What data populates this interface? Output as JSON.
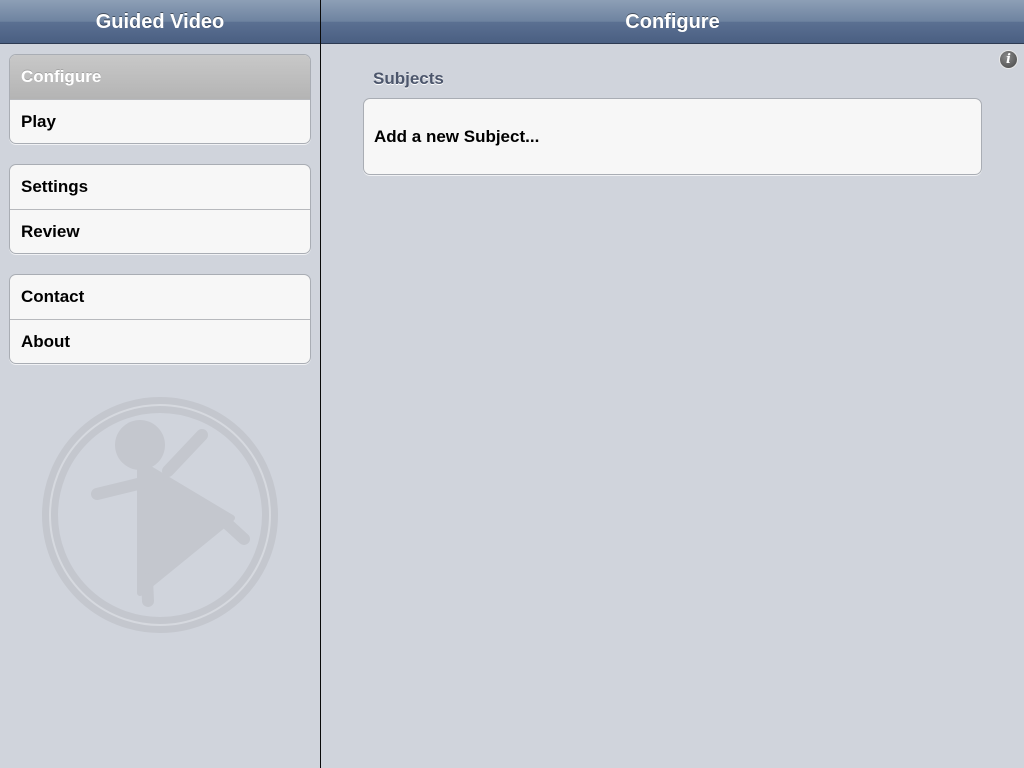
{
  "master": {
    "title": "Guided Video",
    "groups": [
      {
        "items": [
          {
            "label": "Configure",
            "selected": true
          },
          {
            "label": "Play",
            "selected": false
          }
        ]
      },
      {
        "items": [
          {
            "label": "Settings",
            "selected": false
          },
          {
            "label": "Review",
            "selected": false
          }
        ]
      },
      {
        "items": [
          {
            "label": "Contact",
            "selected": false
          },
          {
            "label": "About",
            "selected": false
          }
        ]
      }
    ],
    "logo_icon": "guided-video-logo-icon"
  },
  "detail": {
    "title": "Configure",
    "info_icon": "info-icon",
    "info_glyph": "i",
    "section_header": "Subjects",
    "rows": [
      {
        "label": "Add a new Subject..."
      }
    ]
  },
  "colors": {
    "background": "#d0d4dc",
    "navbar": "#5b7092",
    "selected_row": "#b4b4b4",
    "section_header": "#4c566c"
  }
}
